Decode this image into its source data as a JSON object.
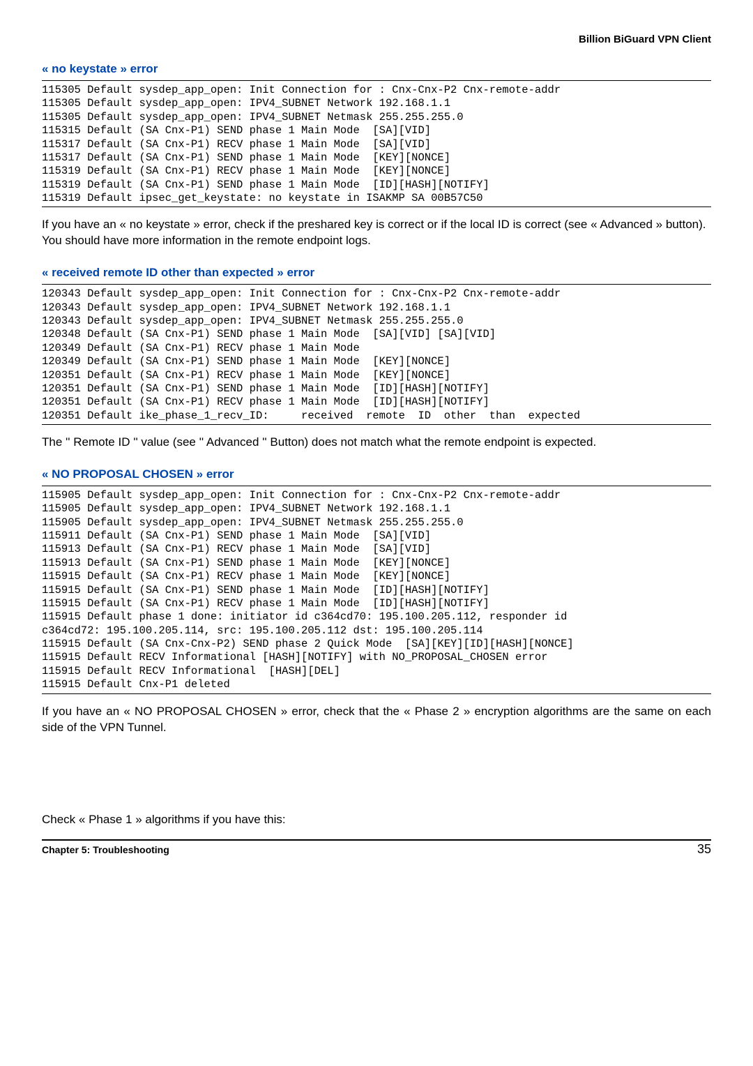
{
  "header": {
    "product": "Billion BiGuard VPN Client"
  },
  "sections": {
    "s1": {
      "title": "« no keystate » error",
      "code": "115305 Default sysdep_app_open: Init Connection for : Cnx-Cnx-P2 Cnx-remote-addr\n115305 Default sysdep_app_open: IPV4_SUBNET Network 192.168.1.1\n115305 Default sysdep_app_open: IPV4_SUBNET Netmask 255.255.255.0\n115315 Default (SA Cnx-P1) SEND phase 1 Main Mode  [SA][VID]\n115317 Default (SA Cnx-P1) RECV phase 1 Main Mode  [SA][VID]\n115317 Default (SA Cnx-P1) SEND phase 1 Main Mode  [KEY][NONCE]\n115319 Default (SA Cnx-P1) RECV phase 1 Main Mode  [KEY][NONCE]\n115319 Default (SA Cnx-P1) SEND phase 1 Main Mode  [ID][HASH][NOTIFY]\n115319 Default ipsec_get_keystate: no keystate in ISAKMP SA 00B57C50",
      "explain": "If you have an « no keystate » error, check if the preshared key is correct or if the local ID is correct (see « Advanced » button). You should have more information in the remote endpoint logs."
    },
    "s2": {
      "title": "« received remote ID other than expected » error",
      "code": "120343 Default sysdep_app_open: Init Connection for : Cnx-Cnx-P2 Cnx-remote-addr\n120343 Default sysdep_app_open: IPV4_SUBNET Network 192.168.1.1\n120343 Default sysdep_app_open: IPV4_SUBNET Netmask 255.255.255.0\n120348 Default (SA Cnx-P1) SEND phase 1 Main Mode  [SA][VID] [SA][VID]\n120349 Default (SA Cnx-P1) RECV phase 1 Main Mode\n120349 Default (SA Cnx-P1) SEND phase 1 Main Mode  [KEY][NONCE]\n120351 Default (SA Cnx-P1) RECV phase 1 Main Mode  [KEY][NONCE]\n120351 Default (SA Cnx-P1) SEND phase 1 Main Mode  [ID][HASH][NOTIFY]\n120351 Default (SA Cnx-P1) RECV phase 1 Main Mode  [ID][HASH][NOTIFY]\n120351 Default ike_phase_1_recv_ID:     received  remote  ID  other  than  expected",
      "explain": "The '' Remote ID '' value (see '' Advanced '' Button) does not match what the remote endpoint is expected."
    },
    "s3": {
      "title": "« NO PROPOSAL CHOSEN » error",
      "code": "115905 Default sysdep_app_open: Init Connection for : Cnx-Cnx-P2 Cnx-remote-addr\n115905 Default sysdep_app_open: IPV4_SUBNET Network 192.168.1.1\n115905 Default sysdep_app_open: IPV4_SUBNET Netmask 255.255.255.0\n115911 Default (SA Cnx-P1) SEND phase 1 Main Mode  [SA][VID]\n115913 Default (SA Cnx-P1) RECV phase 1 Main Mode  [SA][VID]\n115913 Default (SA Cnx-P1) SEND phase 1 Main Mode  [KEY][NONCE]\n115915 Default (SA Cnx-P1) RECV phase 1 Main Mode  [KEY][NONCE]\n115915 Default (SA Cnx-P1) SEND phase 1 Main Mode  [ID][HASH][NOTIFY]\n115915 Default (SA Cnx-P1) RECV phase 1 Main Mode  [ID][HASH][NOTIFY]\n115915 Default phase 1 done: initiator id c364cd70: 195.100.205.112, responder id\nc364cd72: 195.100.205.114, src: 195.100.205.112 dst: 195.100.205.114\n115915 Default (SA Cnx-Cnx-P2) SEND phase 2 Quick Mode  [SA][KEY][ID][HASH][NONCE]\n115915 Default RECV Informational [HASH][NOTIFY] with NO_PROPOSAL_CHOSEN error\n115915 Default RECV Informational  [HASH][DEL]\n115915 Default Cnx-P1 deleted",
      "explain": "If you have an « NO PROPOSAL CHOSEN » error, check that the « Phase 2 » encryption algorithms are the same on each side of the VPN Tunnel.",
      "explain2": "Check « Phase 1 » algorithms if you have this:"
    }
  },
  "footer": {
    "chapter": "Chapter 5: Troubleshooting",
    "page": "35"
  }
}
